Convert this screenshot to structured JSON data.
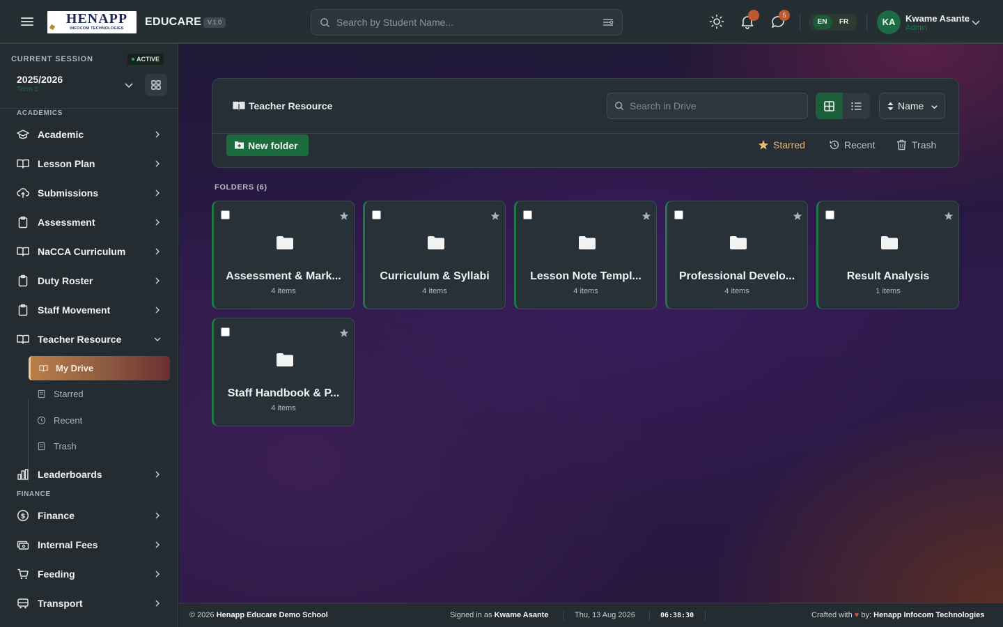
{
  "header": {
    "logo": {
      "big": "HENAPP",
      "small": "INFOCOM TECHNOLOGIES"
    },
    "brand": "EDUCARE",
    "version": "V.1.0",
    "search_placeholder": "Search by Student Name...",
    "notification_count": "",
    "messages_count": "5",
    "languages": [
      "EN",
      "FR"
    ],
    "active_language": "EN",
    "user": {
      "initials": "KA",
      "name": "Kwame Asante",
      "role": "Admin"
    }
  },
  "sidebar": {
    "session_label": "CURRENT SESSION",
    "session_status": "ACTIVE",
    "session_year": "2025/2026",
    "session_term": "Term 3",
    "section_academics": "ACADEMICS",
    "section_finance": "FINANCE",
    "items": [
      {
        "label": "Academic",
        "icon": "graduation-cap-icon"
      },
      {
        "label": "Lesson Plan",
        "icon": "book-open-icon"
      },
      {
        "label": "Submissions",
        "icon": "cloud-upload-icon"
      },
      {
        "label": "Assessment",
        "icon": "clipboard-icon"
      },
      {
        "label": "NaCCA Curriculum",
        "icon": "book-open-icon"
      },
      {
        "label": "Duty Roster",
        "icon": "clipboard-icon"
      },
      {
        "label": "Staff Movement",
        "icon": "clipboard-icon"
      },
      {
        "label": "Teacher Resource",
        "icon": "book-open-icon"
      },
      {
        "label": "Leaderboards",
        "icon": "bar-chart-icon"
      }
    ],
    "teacher_resource_sub": [
      {
        "label": "My Drive",
        "icon": "book-open-icon"
      },
      {
        "label": "Starred",
        "icon": "document-icon"
      },
      {
        "label": "Recent",
        "icon": "clock-icon"
      },
      {
        "label": "Trash",
        "icon": "document-icon"
      }
    ],
    "finance_items": [
      {
        "label": "Finance",
        "icon": "dollar-circle-icon"
      },
      {
        "label": "Internal Fees",
        "icon": "money-icon"
      },
      {
        "label": "Feeding",
        "icon": "cart-icon"
      },
      {
        "label": "Transport",
        "icon": "bus-icon"
      }
    ]
  },
  "drive": {
    "title": "Teacher Resource",
    "search_placeholder": "Search in Drive",
    "view": "grid",
    "sort_label": "Name",
    "new_folder_label": "New folder",
    "filters": {
      "starred": "Starred",
      "recent": "Recent",
      "trash": "Trash"
    },
    "folders_label": "FOLDERS (6)",
    "folders": [
      {
        "name": "Assessment & Marking Schemes",
        "display": "Assessment & Mark...",
        "count": "4 items"
      },
      {
        "name": "Curriculum & Syllabi",
        "display": "Curriculum & Syllabi",
        "count": "4 items"
      },
      {
        "name": "Lesson Note Templates",
        "display": "Lesson Note Templ...",
        "count": "4 items"
      },
      {
        "name": "Professional Development",
        "display": "Professional Develo...",
        "count": "4 items"
      },
      {
        "name": "Result Analysis",
        "display": "Result Analysis",
        "count": "1 items"
      },
      {
        "name": "Staff Handbook & Policies",
        "display": "Staff Handbook & P...",
        "count": "4 items"
      }
    ]
  },
  "footer": {
    "copyright_prefix": "© 2026",
    "school": "Henapp Educare Demo School",
    "signed_in_prefix": "Signed in as",
    "signed_in_user": "Kwame Asante",
    "date": "Thu, 13 Aug 2026",
    "time": "06:38:30",
    "crafted_prefix": "Crafted with",
    "crafted_by": "by:",
    "company": "Henapp Infocom Technologies"
  },
  "colors": {
    "accent_green": "#1c6b3f",
    "active_gradient_start": "#b97f48",
    "starred": "#e9b97b"
  }
}
